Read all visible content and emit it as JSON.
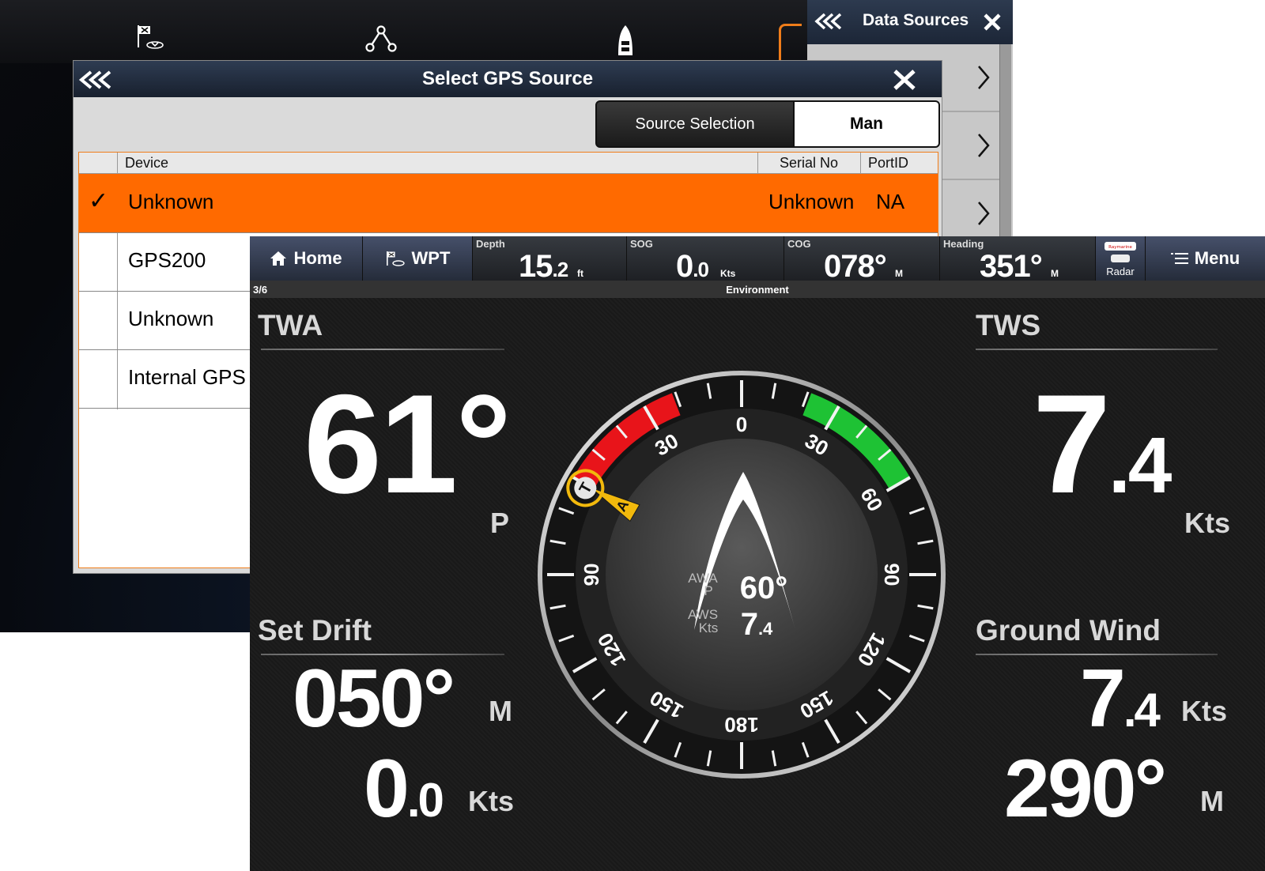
{
  "background_app": {
    "toolbar_icons": [
      "waypoint-flag-icon",
      "route-icon",
      "boat-icon"
    ]
  },
  "data_sources": {
    "title": "Data Sources",
    "back_icon": "triple-chevron-left-icon",
    "close_icon": "close-icon",
    "row_count": 3
  },
  "gps_dialog": {
    "title": "Select GPS Source",
    "segmented": {
      "option1": "Source Selection",
      "option2": "Man"
    },
    "columns": {
      "device": "Device",
      "serial": "Serial No",
      "port": "PortID"
    },
    "rows": [
      {
        "check": "✓",
        "device": "Unknown",
        "serial": "Unknown",
        "port": "NA",
        "selected": true
      },
      {
        "check": "",
        "device": "GPS200",
        "serial": "",
        "port": "",
        "selected": false
      },
      {
        "check": "",
        "device": "Unknown",
        "serial": "",
        "port": "",
        "selected": false
      },
      {
        "check": "",
        "device": "Internal GPS",
        "serial": "",
        "port": "",
        "selected": false
      }
    ]
  },
  "topbar": {
    "home": "Home",
    "wpt": "WPT",
    "depth": {
      "label": "Depth",
      "int": "15",
      "dec": ".2",
      "unit": "ft"
    },
    "sog": {
      "label": "SOG",
      "int": "0",
      "dec": ".0",
      "unit": "Kts"
    },
    "cog": {
      "label": "COG",
      "value": "078°",
      "unit": "M"
    },
    "heading": {
      "label": "Heading",
      "value": "351°",
      "unit": "M"
    },
    "radar": "Radar",
    "radar_brand": "Raymarine",
    "menu": "Menu"
  },
  "page": {
    "index": "3/6",
    "name": "Environment"
  },
  "twa": {
    "label": "TWA",
    "value": "61°",
    "side": "P"
  },
  "tws": {
    "label": "TWS",
    "int": "7",
    "dec": ".4",
    "unit": "Kts"
  },
  "set_drift": {
    "label": "Set Drift",
    "set": "050°",
    "set_unit": "M",
    "drift_int": "0",
    "drift_dec": ".0",
    "drift_unit": "Kts"
  },
  "ground_wind": {
    "label": "Ground Wind",
    "speed_int": "7",
    "speed_dec": ".4",
    "speed_unit": "Kts",
    "dir": "290°",
    "dir_unit": "M"
  },
  "dial": {
    "labels": [
      {
        "text": "0",
        "angle": 0
      },
      {
        "text": "30",
        "angle": 30
      },
      {
        "text": "60",
        "angle": 60
      },
      {
        "text": "90",
        "angle": 90
      },
      {
        "text": "120",
        "angle": 120
      },
      {
        "text": "150",
        "angle": 150
      },
      {
        "text": "180",
        "angle": 180
      },
      {
        "text": "150",
        "angle": 210
      },
      {
        "text": "120",
        "angle": 240
      },
      {
        "text": "90",
        "angle": 270
      },
      {
        "text": "30",
        "angle": 330
      }
    ],
    "true_marker": "T",
    "apparent_marker": "A",
    "awa_label": "AWA",
    "awa_side": "P",
    "awa_value": "60°",
    "aws_label": "AWS",
    "aws_unit": "Kts",
    "aws_int": "7",
    "aws_dec": ".4",
    "colors": {
      "port": "#e8141a",
      "starboard": "#1ec234",
      "marker": "#f2b90c"
    }
  }
}
